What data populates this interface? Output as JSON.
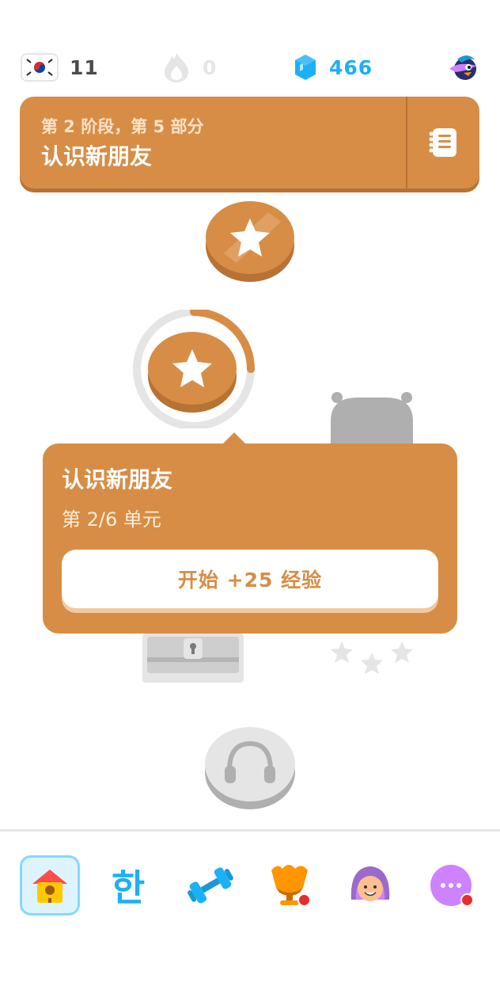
{
  "topbar": {
    "course_flag": "korea-flag-icon",
    "streak_count": "11",
    "streak_icon": "flame-icon",
    "hearts_count": "0",
    "gems_count": "466",
    "gems_icon": "gem-icon",
    "super_icon": "super-duo-icon"
  },
  "unit": {
    "subtitle": "第 2 阶段，第 5 部分",
    "title": "认识新朋友",
    "guide_icon": "guidebook-icon"
  },
  "path": {
    "completed_lesson_icon": "star-icon",
    "current_lesson_icon": "star-icon",
    "current_progress": 0.25,
    "chest_icon": "treasure-chest-icon",
    "audio_lesson_icon": "headphones-icon"
  },
  "popup": {
    "title": "认识新朋友",
    "subtitle": "第 2/6 单元",
    "start_label": "开始 +25 经验"
  },
  "nav": {
    "home_icon": "home-icon",
    "characters_label": "한",
    "practice_icon": "dumbbell-icon",
    "leaderboard_icon": "league-trophy-icon",
    "profile_icon": "avatar-icon",
    "more_icon": "more-icon"
  },
  "colors": {
    "unit": "#D78D45",
    "unit_dark": "#B77234",
    "gems": "#1CB0F6",
    "locked": "#E5E5E5"
  }
}
